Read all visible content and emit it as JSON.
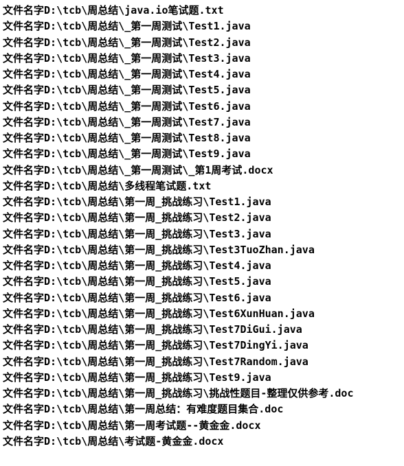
{
  "prefix": "文件名字",
  "lines": [
    "D:\\tcb\\周总结\\java.io笔试题.txt",
    "D:\\tcb\\周总结\\_第一周测试\\Test1.java",
    "D:\\tcb\\周总结\\_第一周测试\\Test2.java",
    "D:\\tcb\\周总结\\_第一周测试\\Test3.java",
    "D:\\tcb\\周总结\\_第一周测试\\Test4.java",
    "D:\\tcb\\周总结\\_第一周测试\\Test5.java",
    "D:\\tcb\\周总结\\_第一周测试\\Test6.java",
    "D:\\tcb\\周总结\\_第一周测试\\Test7.java",
    "D:\\tcb\\周总结\\_第一周测试\\Test8.java",
    "D:\\tcb\\周总结\\_第一周测试\\Test9.java",
    "D:\\tcb\\周总结\\_第一周测试\\_第1周考试.docx",
    "D:\\tcb\\周总结\\多线程笔试题.txt",
    "D:\\tcb\\周总结\\第一周_挑战练习\\Test1.java",
    "D:\\tcb\\周总结\\第一周_挑战练习\\Test2.java",
    "D:\\tcb\\周总结\\第一周_挑战练习\\Test3.java",
    "D:\\tcb\\周总结\\第一周_挑战练习\\Test3TuoZhan.java",
    "D:\\tcb\\周总结\\第一周_挑战练习\\Test4.java",
    "D:\\tcb\\周总结\\第一周_挑战练习\\Test5.java",
    "D:\\tcb\\周总结\\第一周_挑战练习\\Test6.java",
    "D:\\tcb\\周总结\\第一周_挑战练习\\Test6XunHuan.java",
    "D:\\tcb\\周总结\\第一周_挑战练习\\Test7DiGui.java",
    "D:\\tcb\\周总结\\第一周_挑战练习\\Test7DingYi.java",
    "D:\\tcb\\周总结\\第一周_挑战练习\\Test7Random.java",
    "D:\\tcb\\周总结\\第一周_挑战练习\\Test9.java",
    "D:\\tcb\\周总结\\第一周_挑战练习\\挑战性题目-整理仅供参考.doc",
    "D:\\tcb\\周总结\\第一周总结：有难度题目集合.doc",
    "D:\\tcb\\周总结\\第一周考试题--黄金金.docx",
    "D:\\tcb\\周总结\\考试题-黄金金.docx"
  ]
}
